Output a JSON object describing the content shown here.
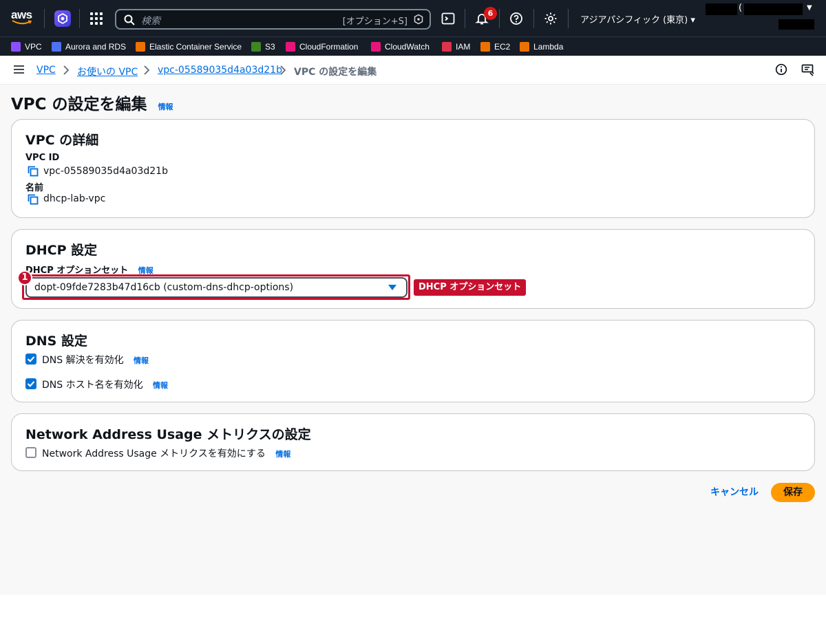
{
  "topnav": {
    "logo_text": "aws",
    "search_placeholder": "検索",
    "search_shortcut": "[オプション+S]",
    "notifications_count": "6",
    "region": "アジアパシフィック (東京) ▾",
    "account_paren": "("
  },
  "favorites": [
    {
      "label": "VPC",
      "color": "#8c4fff"
    },
    {
      "label": "Aurora and RDS",
      "color": "#4d72f3"
    },
    {
      "label": "Elastic Container Service",
      "color": "#ed7100"
    },
    {
      "label": "S3",
      "color": "#3f8624"
    },
    {
      "label": "CloudFormation",
      "color": "#e7157b"
    },
    {
      "label": "CloudWatch",
      "color": "#e7157b"
    },
    {
      "label": "IAM",
      "color": "#dd344c"
    },
    {
      "label": "EC2",
      "color": "#ed7100"
    },
    {
      "label": "Lambda",
      "color": "#ed7100"
    }
  ],
  "breadcrumb": {
    "items": [
      "VPC",
      "お使いの VPC",
      "vpc-05589035d4a03d21b"
    ],
    "current": "VPC の設定を編集"
  },
  "page": {
    "title": "VPC の設定を編集",
    "info": "情報"
  },
  "vpc_details": {
    "heading": "VPC の詳細",
    "vpc_id_label": "VPC ID",
    "vpc_id_value": "vpc-05589035d4a03d21b",
    "name_label": "名前",
    "name_value": "dhcp-lab-vpc"
  },
  "dhcp": {
    "heading": "DHCP 設定",
    "field_label": "DHCP オプションセット",
    "info": "情報",
    "selected": "dopt-09fde7283b47d16cb (custom-dns-dhcp-options)",
    "annotation_number": "1",
    "annotation_label": "DHCP オプションセット"
  },
  "dns": {
    "heading": "DNS 設定",
    "resolution_label": "DNS 解決を有効化",
    "resolution_checked": true,
    "hostnames_label": "DNS ホスト名を有効化",
    "hostnames_checked": true,
    "info": "情報"
  },
  "nau": {
    "heading": "Network Address Usage メトリクスの設定",
    "checkbox_label": "Network Address Usage メトリクスを有効にする",
    "checked": false,
    "info": "情報"
  },
  "actions": {
    "cancel": "キャンセル",
    "save": "保存"
  },
  "colors": {
    "nav_bg": "#161d26",
    "link": "#006ce0",
    "primary_button": "#ff9900",
    "annotation_red": "#c7102e"
  }
}
